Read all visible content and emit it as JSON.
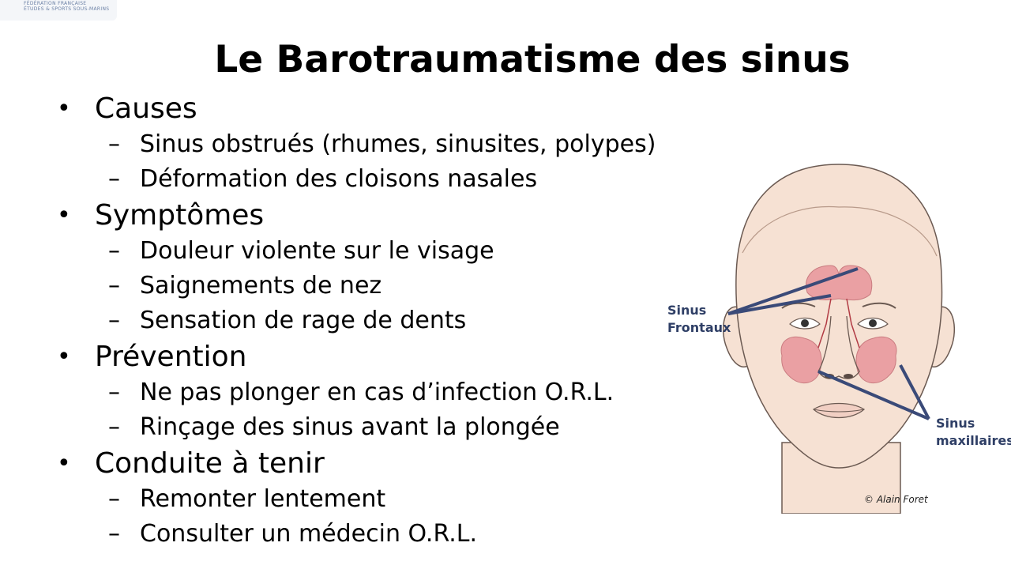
{
  "logo": {
    "line1": "FÉDÉRATION FRANÇAISE",
    "line2": "ÉTUDES & SPORTS SOUS-MARINS"
  },
  "title": "Le Barotraumatisme des sinus",
  "bullet_symbol": "•",
  "dash_symbol": "–",
  "sections": [
    {
      "heading": "Causes",
      "items": [
        "Sinus obstrués (rhumes, sinusites, polypes)",
        "Déformation des cloisons nasales"
      ]
    },
    {
      "heading": "Symptômes",
      "items": [
        "Douleur violente sur le visage",
        "Saignements de nez",
        "Sensation de rage de dents"
      ]
    },
    {
      "heading": "Prévention",
      "items": [
        "Ne pas plonger en cas d’infection O.R.L.",
        "Rinçage des sinus avant la plongée"
      ]
    },
    {
      "heading": "Conduite à tenir",
      "items": [
        "Remonter lentement",
        "Consulter un médecin O.R.L."
      ]
    }
  ],
  "figure": {
    "label_frontal_1": "Sinus",
    "label_frontal_2": "Frontaux",
    "label_maxillary_1": "Sinus",
    "label_maxillary_2": "maxillaires",
    "copyright": "© Alain Foret",
    "colors": {
      "skin": "#f6e1d3",
      "sinus": "#eaa0a3",
      "pointer": "#3a4a78",
      "outline": "#6b5a52"
    }
  }
}
